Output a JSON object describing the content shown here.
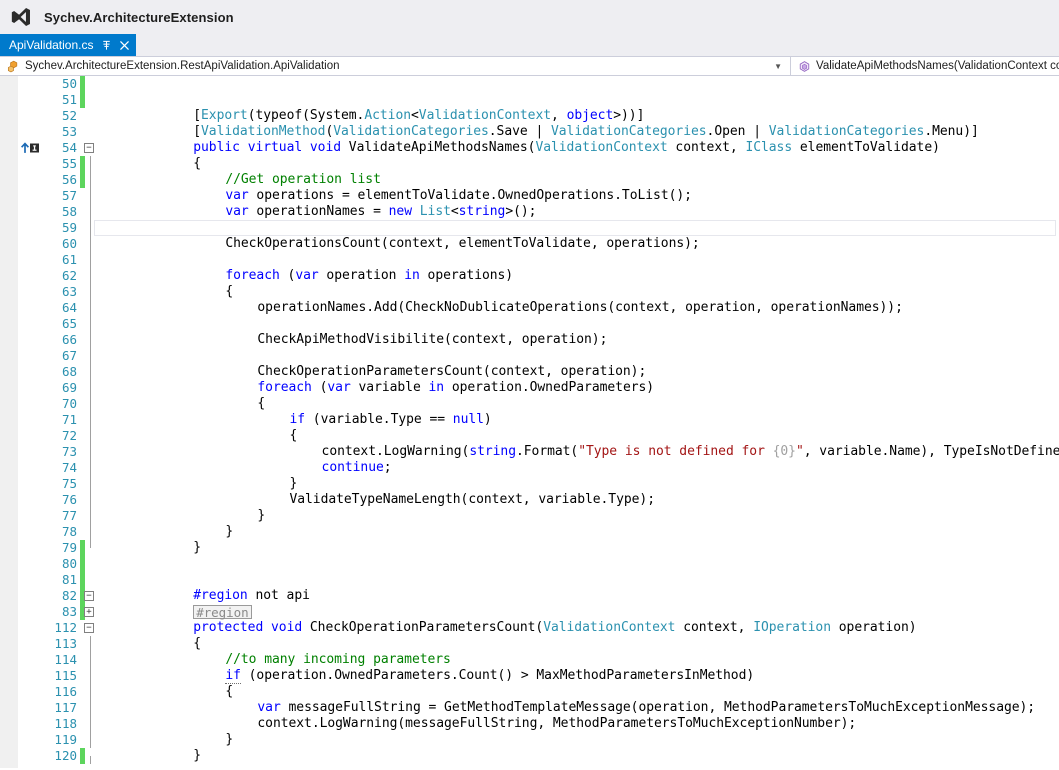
{
  "window": {
    "title": "Sychev.ArchitectureExtension",
    "logo_icon": "visual-studio-logo"
  },
  "tab": {
    "label": "ApiValidation.cs",
    "pin_icon": "pin-icon",
    "close_icon": "close-icon"
  },
  "navbar": {
    "left_icon": "class-icon",
    "left_text": "Sychev.ArchitectureExtension.RestApiValidation.ApiValidation",
    "caret_icon": "chevron-down-icon",
    "right_icon": "method-icon",
    "right_text": "ValidateApiMethodsNames(ValidationContext cont"
  },
  "colors": {
    "accent": "#007acc",
    "titlebar_bg": "#eeeef2",
    "keyword": "#0000ff",
    "type": "#2b91af",
    "comment": "#008000",
    "string": "#a31515",
    "linenumber": "#2b91af",
    "change_added": "#5dd55d",
    "fold_line": "#a0a0a0"
  },
  "editor": {
    "first_visible_line": 50,
    "current_line": 59,
    "lines": [
      {
        "n": 50,
        "change": "added",
        "fold": "",
        "glyph": "",
        "tokens": []
      },
      {
        "n": 51,
        "change": "added",
        "fold": "",
        "glyph": "",
        "tokens": []
      },
      {
        "n": 52,
        "change": "none",
        "fold": "",
        "glyph": "",
        "indent": 12,
        "tokens": [
          {
            "t": "[",
            "c": "pl"
          },
          {
            "t": "Export",
            "c": "ty"
          },
          {
            "t": "(typeof(System.",
            "c": "pl"
          },
          {
            "t": "Action",
            "c": "ty"
          },
          {
            "t": "<",
            "c": "pl"
          },
          {
            "t": "ValidationContext",
            "c": "ty"
          },
          {
            "t": ", ",
            "c": "pl"
          },
          {
            "t": "object",
            "c": "kw"
          },
          {
            "t": ">))]",
            "c": "pl"
          }
        ]
      },
      {
        "n": 53,
        "change": "none",
        "fold": "",
        "glyph": "",
        "indent": 12,
        "tokens": [
          {
            "t": "[",
            "c": "pl"
          },
          {
            "t": "ValidationMethod",
            "c": "ty"
          },
          {
            "t": "(",
            "c": "pl"
          },
          {
            "t": "ValidationCategories",
            "c": "ty"
          },
          {
            "t": ".Save | ",
            "c": "pl"
          },
          {
            "t": "ValidationCategories",
            "c": "ty"
          },
          {
            "t": ".Open | ",
            "c": "pl"
          },
          {
            "t": "ValidationCategories",
            "c": "ty"
          },
          {
            "t": ".Menu)]",
            "c": "pl"
          }
        ]
      },
      {
        "n": 54,
        "change": "none",
        "fold": "minus",
        "glyph": "reference-marker",
        "indent": 12,
        "tokens": [
          {
            "t": "public",
            "c": "kw"
          },
          {
            "t": " ",
            "c": "pl"
          },
          {
            "t": "virtual",
            "c": "kw"
          },
          {
            "t": " ",
            "c": "pl"
          },
          {
            "t": "void",
            "c": "kw"
          },
          {
            "t": " ValidateApiMethodsNames(",
            "c": "pl"
          },
          {
            "t": "ValidationContext",
            "c": "ty"
          },
          {
            "t": " context, ",
            "c": "pl"
          },
          {
            "t": "IClass",
            "c": "ty"
          },
          {
            "t": " elementToValidate)",
            "c": "pl"
          }
        ]
      },
      {
        "n": 55,
        "change": "added",
        "fold": "line",
        "glyph": "",
        "indent": 12,
        "tokens": [
          {
            "t": "{",
            "c": "pl"
          }
        ]
      },
      {
        "n": 56,
        "change": "added",
        "fold": "line",
        "glyph": "",
        "indent": 16,
        "tokens": [
          {
            "t": "//Get operation list",
            "c": "cm"
          }
        ]
      },
      {
        "n": 57,
        "change": "none",
        "fold": "line",
        "glyph": "",
        "indent": 16,
        "tokens": [
          {
            "t": "var",
            "c": "kw"
          },
          {
            "t": " operations = elementToValidate.OwnedOperations.ToList();",
            "c": "pl"
          }
        ]
      },
      {
        "n": 58,
        "change": "none",
        "fold": "line",
        "glyph": "",
        "indent": 16,
        "tokens": [
          {
            "t": "var",
            "c": "kw"
          },
          {
            "t": " operationNames = ",
            "c": "pl"
          },
          {
            "t": "new",
            "c": "kw"
          },
          {
            "t": " ",
            "c": "pl"
          },
          {
            "t": "List",
            "c": "ty"
          },
          {
            "t": "<",
            "c": "pl"
          },
          {
            "t": "string",
            "c": "kw"
          },
          {
            "t": ">();",
            "c": "pl"
          }
        ]
      },
      {
        "n": 59,
        "change": "none",
        "fold": "line",
        "glyph": "",
        "indent": 16,
        "tokens": []
      },
      {
        "n": 60,
        "change": "none",
        "fold": "line",
        "glyph": "",
        "indent": 16,
        "tokens": [
          {
            "t": "CheckOperationsCount(context, elementToValidate, operations);",
            "c": "pl"
          }
        ]
      },
      {
        "n": 61,
        "change": "none",
        "fold": "line",
        "glyph": "",
        "indent": 16,
        "tokens": []
      },
      {
        "n": 62,
        "change": "none",
        "fold": "line",
        "glyph": "",
        "indent": 16,
        "tokens": [
          {
            "t": "foreach",
            "c": "kw"
          },
          {
            "t": " (",
            "c": "pl"
          },
          {
            "t": "var",
            "c": "kw"
          },
          {
            "t": " operation ",
            "c": "pl"
          },
          {
            "t": "in",
            "c": "kw"
          },
          {
            "t": " operations)",
            "c": "pl"
          }
        ]
      },
      {
        "n": 63,
        "change": "none",
        "fold": "line",
        "glyph": "",
        "indent": 16,
        "tokens": [
          {
            "t": "{",
            "c": "pl"
          }
        ]
      },
      {
        "n": 64,
        "change": "none",
        "fold": "line",
        "glyph": "",
        "indent": 20,
        "tokens": [
          {
            "t": "operationNames.Add(CheckNoDublicateOperations(context, operation, operationNames));",
            "c": "pl"
          }
        ]
      },
      {
        "n": 65,
        "change": "none",
        "fold": "line",
        "glyph": "",
        "indent": 20,
        "tokens": []
      },
      {
        "n": 66,
        "change": "none",
        "fold": "line",
        "glyph": "",
        "indent": 20,
        "tokens": [
          {
            "t": "CheckApiMethodVisibilite(context, operation);",
            "c": "pl"
          }
        ]
      },
      {
        "n": 67,
        "change": "none",
        "fold": "line",
        "glyph": "",
        "indent": 20,
        "tokens": []
      },
      {
        "n": 68,
        "change": "none",
        "fold": "line",
        "glyph": "",
        "indent": 20,
        "tokens": [
          {
            "t": "CheckOperationParametersCount(context, operation);",
            "c": "pl"
          }
        ]
      },
      {
        "n": 69,
        "change": "none",
        "fold": "line",
        "glyph": "",
        "indent": 20,
        "tokens": [
          {
            "t": "foreach",
            "c": "kw"
          },
          {
            "t": " (",
            "c": "pl"
          },
          {
            "t": "var",
            "c": "kw"
          },
          {
            "t": " variable ",
            "c": "pl"
          },
          {
            "t": "in",
            "c": "kw"
          },
          {
            "t": " operation.OwnedParameters)",
            "c": "pl"
          }
        ]
      },
      {
        "n": 70,
        "change": "none",
        "fold": "line",
        "glyph": "",
        "indent": 20,
        "tokens": [
          {
            "t": "{",
            "c": "pl"
          }
        ]
      },
      {
        "n": 71,
        "change": "none",
        "fold": "line",
        "glyph": "",
        "indent": 24,
        "tokens": [
          {
            "t": "if",
            "c": "kw"
          },
          {
            "t": " (variable.Type == ",
            "c": "pl"
          },
          {
            "t": "null",
            "c": "kw"
          },
          {
            "t": ")",
            "c": "pl"
          }
        ]
      },
      {
        "n": 72,
        "change": "none",
        "fold": "line",
        "glyph": "",
        "indent": 24,
        "tokens": [
          {
            "t": "{",
            "c": "pl"
          }
        ]
      },
      {
        "n": 73,
        "change": "none",
        "fold": "line",
        "glyph": "",
        "indent": 28,
        "tokens": [
          {
            "t": "context.LogWarning(",
            "c": "pl"
          },
          {
            "t": "string",
            "c": "kw"
          },
          {
            "t": ".Format(",
            "c": "pl"
          },
          {
            "t": "\"Type is not defined for ",
            "c": "st"
          },
          {
            "t": "{0}",
            "c": "sf"
          },
          {
            "t": "\"",
            "c": "st"
          },
          {
            "t": ", variable.Name), TypeIsNotDefineExceptionNumber);",
            "c": "pl"
          }
        ]
      },
      {
        "n": 74,
        "change": "none",
        "fold": "line",
        "glyph": "",
        "indent": 28,
        "tokens": [
          {
            "t": "continue",
            "c": "kw"
          },
          {
            "t": ";",
            "c": "pl"
          }
        ]
      },
      {
        "n": 75,
        "change": "none",
        "fold": "line",
        "glyph": "",
        "indent": 24,
        "tokens": [
          {
            "t": "}",
            "c": "pl"
          }
        ]
      },
      {
        "n": 76,
        "change": "none",
        "fold": "line",
        "glyph": "",
        "indent": 24,
        "tokens": [
          {
            "t": "ValidateTypeNameLength(context, variable.Type);",
            "c": "pl"
          }
        ]
      },
      {
        "n": 77,
        "change": "none",
        "fold": "line",
        "glyph": "",
        "indent": 20,
        "tokens": [
          {
            "t": "}",
            "c": "pl"
          }
        ]
      },
      {
        "n": 78,
        "change": "none",
        "fold": "line",
        "glyph": "",
        "indent": 16,
        "tokens": [
          {
            "t": "}",
            "c": "pl"
          }
        ]
      },
      {
        "n": 79,
        "change": "added",
        "fold": "half-top",
        "glyph": "",
        "indent": 12,
        "tokens": [
          {
            "t": "}",
            "c": "pl"
          }
        ]
      },
      {
        "n": 80,
        "change": "added",
        "fold": "",
        "glyph": "",
        "tokens": []
      },
      {
        "n": 81,
        "change": "added",
        "fold": "",
        "glyph": "",
        "tokens": []
      },
      {
        "n": 82,
        "change": "added",
        "fold": "minus",
        "glyph": "",
        "indent": 12,
        "tokens": [
          {
            "t": "#region",
            "c": "pp"
          },
          {
            "t": " not api",
            "c": "pl"
          }
        ]
      },
      {
        "n": 83,
        "change": "added",
        "fold": "plus",
        "glyph": "",
        "indent": 12,
        "collapsed_region": "#region",
        "tokens": []
      },
      {
        "n": 112,
        "change": "none",
        "fold": "minus",
        "glyph": "",
        "indent": 12,
        "tokens": [
          {
            "t": "protected",
            "c": "kw"
          },
          {
            "t": " ",
            "c": "pl"
          },
          {
            "t": "void",
            "c": "kw"
          },
          {
            "t": " CheckOperationParametersCount(",
            "c": "pl"
          },
          {
            "t": "ValidationContext",
            "c": "ty"
          },
          {
            "t": " context, ",
            "c": "pl"
          },
          {
            "t": "IOperation",
            "c": "ty"
          },
          {
            "t": " operation)",
            "c": "pl"
          }
        ]
      },
      {
        "n": 113,
        "change": "none",
        "fold": "line",
        "glyph": "",
        "indent": 12,
        "tokens": [
          {
            "t": "{",
            "c": "pl"
          }
        ]
      },
      {
        "n": 114,
        "change": "none",
        "fold": "line",
        "glyph": "",
        "indent": 16,
        "tokens": [
          {
            "t": "//to many incoming parameters",
            "c": "cm"
          }
        ]
      },
      {
        "n": 115,
        "change": "none",
        "fold": "line",
        "glyph": "",
        "indent": 16,
        "tokens": [
          {
            "t": "if",
            "c": "kw squig"
          },
          {
            "t": " (operation.OwnedParameters.Count() > MaxMethodParametersInMethod)",
            "c": "pl"
          }
        ]
      },
      {
        "n": 116,
        "change": "none",
        "fold": "line",
        "glyph": "",
        "indent": 16,
        "tokens": [
          {
            "t": "{",
            "c": "pl"
          }
        ]
      },
      {
        "n": 117,
        "change": "none",
        "fold": "line",
        "glyph": "",
        "indent": 20,
        "tokens": [
          {
            "t": "var",
            "c": "kw"
          },
          {
            "t": " messageFullString = GetMethodTemplateMessage(operation, MethodParametersToMuchExceptionMessage);",
            "c": "pl"
          }
        ]
      },
      {
        "n": 118,
        "change": "none",
        "fold": "line",
        "glyph": "",
        "indent": 20,
        "tokens": [
          {
            "t": "context.LogWarning(messageFullString, MethodParametersToMuchExceptionNumber);",
            "c": "pl"
          }
        ]
      },
      {
        "n": 119,
        "change": "none",
        "fold": "line",
        "glyph": "",
        "indent": 16,
        "tokens": [
          {
            "t": "}",
            "c": "pl"
          }
        ]
      },
      {
        "n": 120,
        "change": "added",
        "fold": "half-bot",
        "glyph": "",
        "indent": 12,
        "tokens": [
          {
            "t": "}",
            "c": "pl"
          }
        ]
      }
    ]
  }
}
